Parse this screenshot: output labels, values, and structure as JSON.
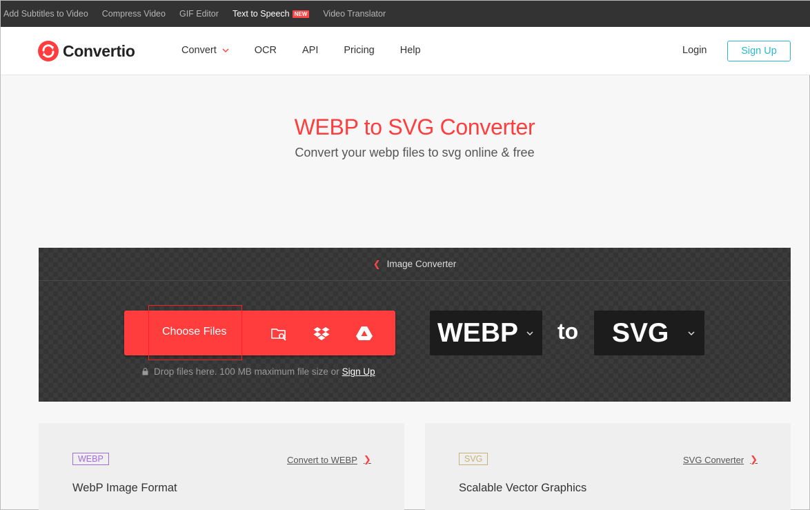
{
  "topbar": {
    "links": [
      "Add Subtitles to Video",
      "Compress Video",
      "GIF Editor",
      "Text to Speech",
      "Video Translator"
    ],
    "new_badge": "NEW"
  },
  "header": {
    "logo_text": "Convertio",
    "nav": [
      "Convert",
      "OCR",
      "API",
      "Pricing",
      "Help"
    ],
    "login": "Login",
    "signup": "Sign Up"
  },
  "hero": {
    "title": "WEBP to SVG Converter",
    "subtitle": "Convert your webp files to svg online & free"
  },
  "converter": {
    "breadcrumb": "Image Converter",
    "choose_files": "Choose Files",
    "source_icons": [
      "folder-search-icon",
      "dropbox-icon",
      "google-drive-icon"
    ],
    "drop_text": "Drop files here. 100 MB maximum file size or",
    "drop_link": "Sign Up",
    "from_format": "WEBP",
    "to_word": "to",
    "to_format": "SVG"
  },
  "cards": [
    {
      "tag": "WEBP",
      "link": "Convert to WEBP",
      "title": "WebP Image Format",
      "tag_color": "#a26bd9"
    },
    {
      "tag": "SVG",
      "link": "SVG Converter",
      "title": "Scalable Vector Graphics",
      "tag_color": "#c8b278"
    }
  ],
  "colors": {
    "accent": "#ff3d3d",
    "signup": "#2ab8cf",
    "dark": "#333333"
  }
}
